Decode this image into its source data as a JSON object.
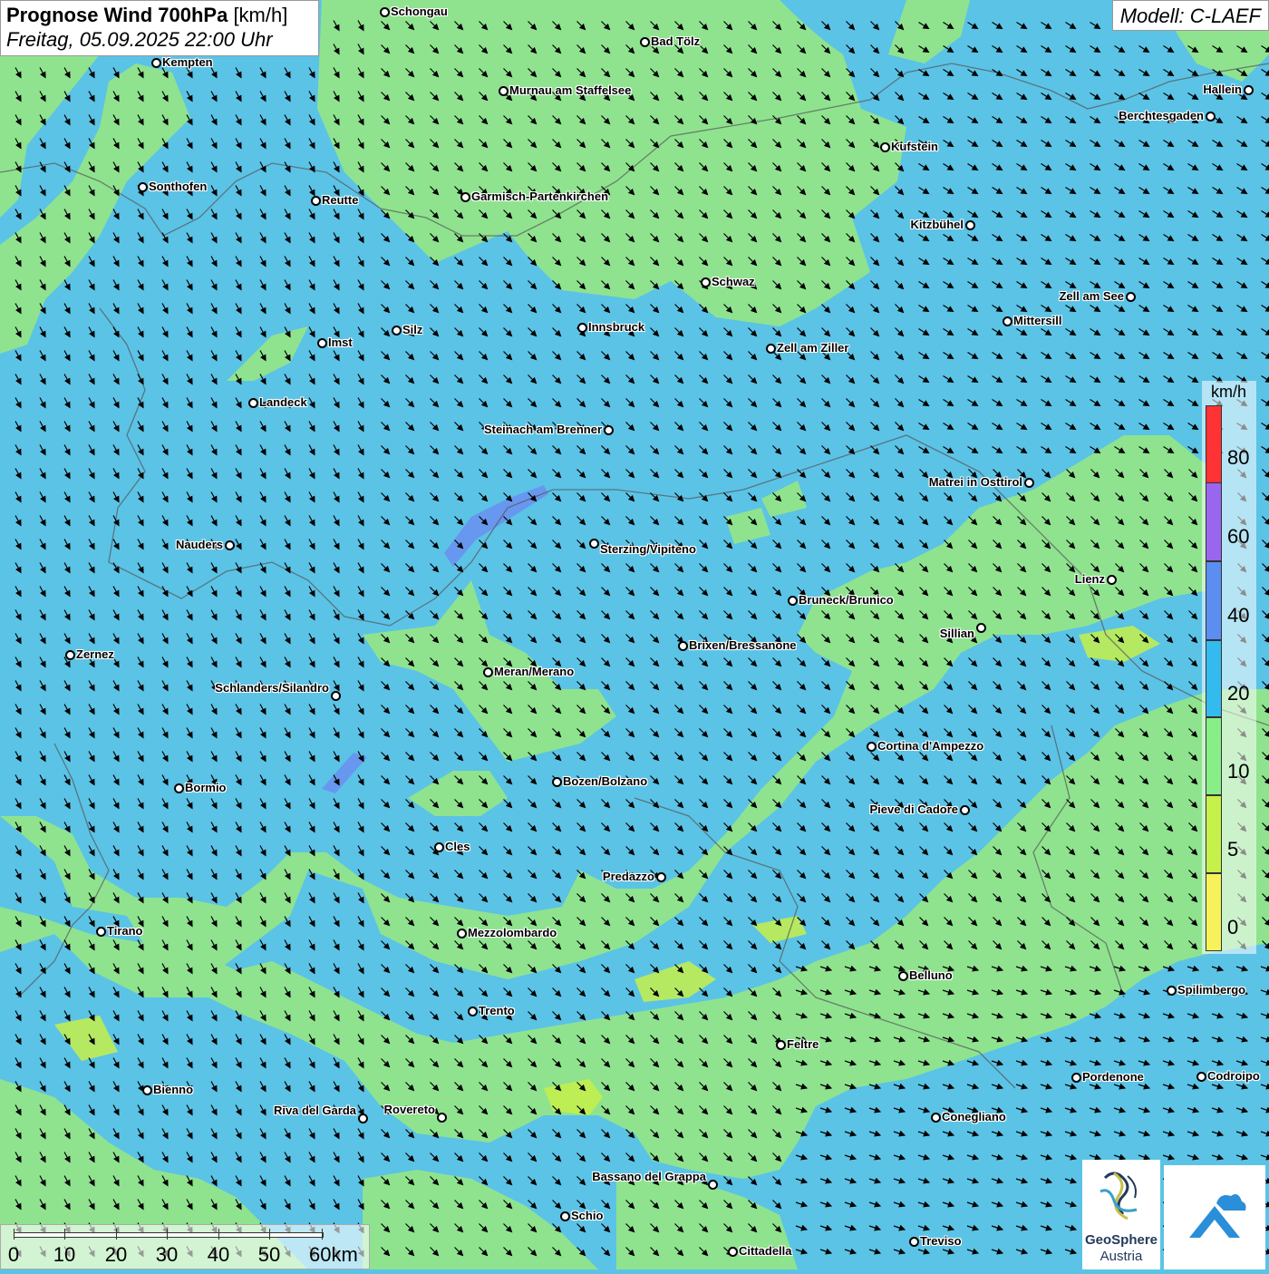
{
  "header": {
    "title_bold": "Prognose Wind 700hPa",
    "title_unit": "[km/h]",
    "datetime": "Freitag, 05.09.2025 22:00 Uhr",
    "model": "Modell: C-LAEF"
  },
  "cities": [
    {
      "name": "Schongau"
    },
    {
      "name": "Bad Tölz"
    },
    {
      "name": "Kempten"
    },
    {
      "name": "Murnau am Staffelsee"
    },
    {
      "name": "Hallein"
    },
    {
      "name": "Berchtesgaden"
    },
    {
      "name": "Kufstein"
    },
    {
      "name": "Sonthofen"
    },
    {
      "name": "Reutte"
    },
    {
      "name": "Garmisch-Partenkirchen"
    },
    {
      "name": "Kitzbühel"
    },
    {
      "name": "Schwaz"
    },
    {
      "name": "Zell am See"
    },
    {
      "name": "Mittersill"
    },
    {
      "name": "Innsbruck"
    },
    {
      "name": "Silz"
    },
    {
      "name": "Imst"
    },
    {
      "name": "Zell am Ziller"
    },
    {
      "name": "Landeck"
    },
    {
      "name": "Steinach am Brenner"
    },
    {
      "name": "Matrei in Osttirol"
    },
    {
      "name": "Nauders"
    },
    {
      "name": "Sterzing/Vipiteno"
    },
    {
      "name": "Lienz"
    },
    {
      "name": "Bruneck/Brunico"
    },
    {
      "name": "Sillian"
    },
    {
      "name": "Zernez"
    },
    {
      "name": "Brixen/Bressanone"
    },
    {
      "name": "Meran/Merano"
    },
    {
      "name": "Schlanders/Silandro"
    },
    {
      "name": "Cortina d'Ampezzo"
    },
    {
      "name": "Bozen/Bolzano"
    },
    {
      "name": "Bormio"
    },
    {
      "name": "Pieve di Cadore"
    },
    {
      "name": "Cles"
    },
    {
      "name": "Predazzo"
    },
    {
      "name": "Tirano"
    },
    {
      "name": "Mezzolombardo"
    },
    {
      "name": "Belluno"
    },
    {
      "name": "Spilimbergo"
    },
    {
      "name": "Trento"
    },
    {
      "name": "Feltre"
    },
    {
      "name": "Pordenone"
    },
    {
      "name": "Codroipo"
    },
    {
      "name": "Bienno"
    },
    {
      "name": "Riva del Garda"
    },
    {
      "name": "Rovereto"
    },
    {
      "name": "Conegliano"
    },
    {
      "name": "Bassano del Grappa"
    },
    {
      "name": "Schio"
    },
    {
      "name": "Treviso"
    },
    {
      "name": "Cittadella"
    }
  ],
  "legend": {
    "unit": "km/h",
    "labels": [
      "80",
      "60",
      "40",
      "20",
      "10",
      "5",
      "0"
    ],
    "colors": [
      "#ff3333",
      "#9966ee",
      "#5b8ef0",
      "#33bbee",
      "#88ee88",
      "#c6f04a",
      "#f7f25a"
    ]
  },
  "scale": {
    "labels": [
      "0",
      "10",
      "20",
      "30",
      "40",
      "50",
      "60km"
    ]
  },
  "logo": {
    "line1": "GeoSphere",
    "line2": "Austria"
  },
  "colors": {
    "wind_10_20": "#8fe38f",
    "wind_20_40": "#5bc3e6",
    "wind_40_60": "#6a8ff0",
    "wind_5_10": "#c6f04a"
  },
  "wind_direction": "northwest, arrows pointing to south-east"
}
